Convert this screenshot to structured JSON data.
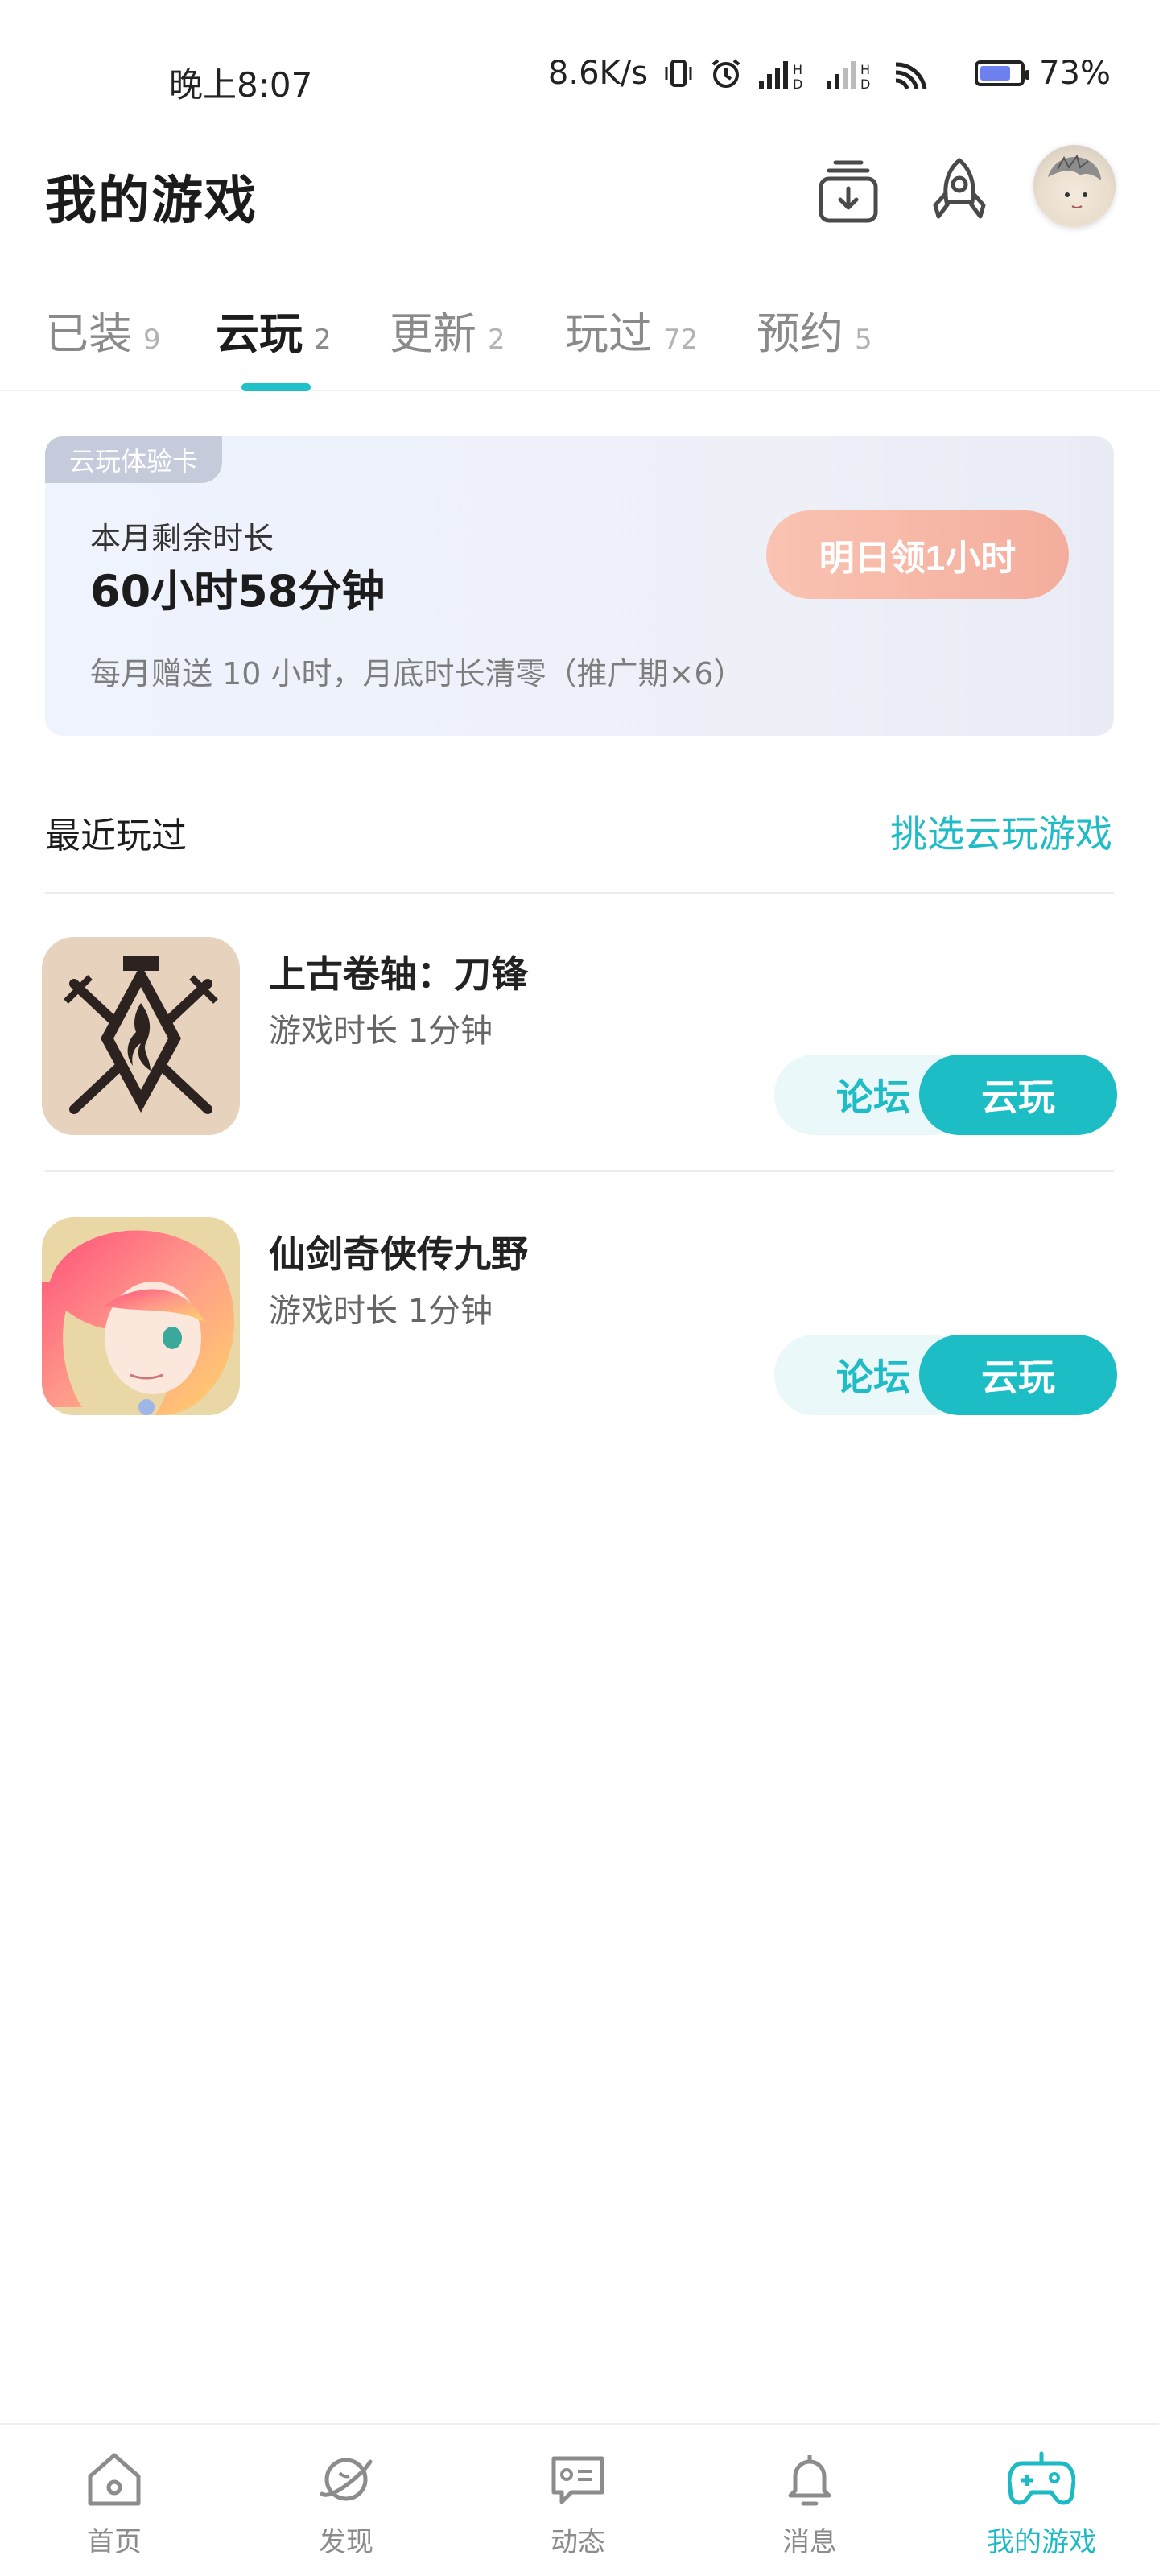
{
  "status_bar": {
    "time": "晚上8:07",
    "speed": "8.6K/s",
    "battery": "73%",
    "battery_level": 0.73
  },
  "header": {
    "title": "我的游戏",
    "icons": [
      "download-manager-icon",
      "rocket-icon",
      "avatar"
    ]
  },
  "tabs": [
    {
      "label": "已装",
      "count": "9"
    },
    {
      "label": "云玩",
      "count": "2"
    },
    {
      "label": "更新",
      "count": "2"
    },
    {
      "label": "玩过",
      "count": "72"
    },
    {
      "label": "预约",
      "count": "5"
    }
  ],
  "active_tab": "云玩",
  "cloud_card": {
    "tag": "云玩体验卡",
    "label": "本月剩余时长",
    "value": "60小时58分钟",
    "button": "明日领1小时",
    "note": "每月赠送 10 小时，月底时长清零（推广期×6）"
  },
  "recent": {
    "title": "最近玩过",
    "link": "挑选云玩游戏",
    "games": [
      {
        "name": "上古卷轴：刀锋",
        "playtime": "游戏时长 1分钟",
        "forum": "论坛",
        "cloud": "云玩"
      },
      {
        "name": "仙剑奇侠传九野",
        "playtime": "游戏时长 1分钟",
        "forum": "论坛",
        "cloud": "云玩"
      }
    ]
  },
  "bottom_nav": [
    {
      "label": "首页",
      "icon": "home-icon"
    },
    {
      "label": "发现",
      "icon": "planet-icon"
    },
    {
      "label": "动态",
      "icon": "chat-card-icon"
    },
    {
      "label": "消息",
      "icon": "bell-icon"
    },
    {
      "label": "我的游戏",
      "icon": "gamepad-icon"
    }
  ],
  "colors": {
    "accent": "#1dbdc6",
    "card_button": "#f4ad9d",
    "card_bg": "#eef3fd"
  }
}
